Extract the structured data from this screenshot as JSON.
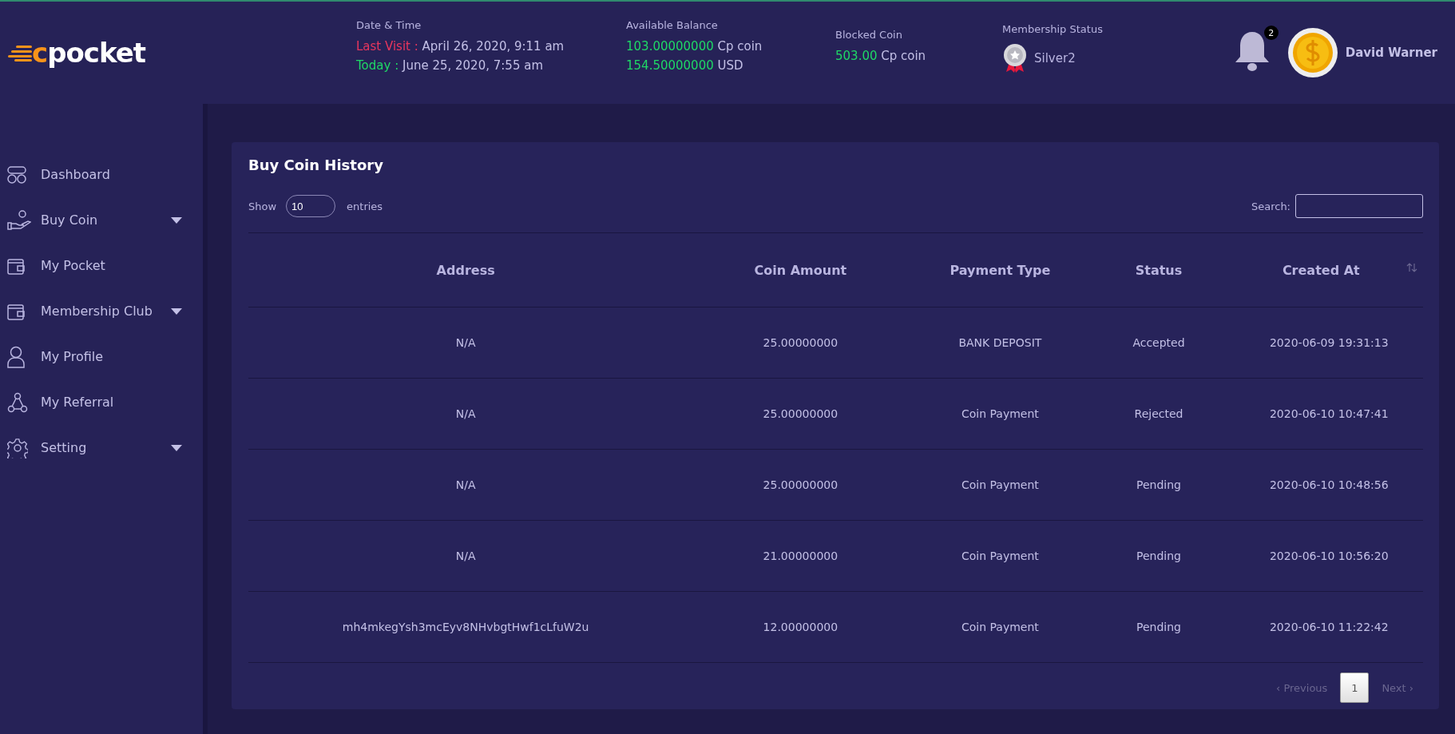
{
  "logo": {
    "accent": "c",
    "text": "pocket"
  },
  "header_info": [
    {
      "label": "Date & Time",
      "lines": [
        {
          "prefix": "Last Visit :",
          "value": " April 26, 2020, 9:11 am",
          "color": "#e8365d"
        },
        {
          "prefix": "Today :",
          "value": " June 25, 2020, 7:55 am",
          "color": "#1fd866"
        }
      ]
    },
    {
      "label": "Available Balance",
      "lines": [
        {
          "prefix": "103.00000000",
          "value": " Cp coin",
          "color": "#1fd866"
        },
        {
          "prefix": "154.50000000",
          "value": " USD",
          "color": "#1fd866"
        }
      ]
    },
    {
      "label": "Blocked Coin",
      "lines": [
        {
          "prefix": "503.00",
          "value": " Cp coin",
          "color": "#1fd866"
        }
      ]
    }
  ],
  "membership": {
    "label": "Membership Status",
    "value": "Silver2"
  },
  "notifications": {
    "count": "2"
  },
  "user": {
    "name": "David Warner"
  },
  "sidebar": {
    "items": [
      {
        "label": "Dashboard",
        "kind": "link"
      },
      {
        "label": "Buy Coin",
        "kind": "dropdown"
      },
      {
        "label": "My Pocket",
        "kind": "link"
      },
      {
        "label": "Membership Club",
        "kind": "dropdown"
      },
      {
        "label": "My Profile",
        "kind": "link"
      },
      {
        "label": "My Referral",
        "kind": "link"
      },
      {
        "label": "Setting",
        "kind": "dropdown"
      }
    ]
  },
  "card": {
    "title": "Buy Coin History",
    "show_label": "Show",
    "entries_value": "10",
    "entries_label": "entries",
    "search_label": "Search:"
  },
  "table": {
    "columns": [
      "Address",
      "Coin Amount",
      "Payment Type",
      "Status",
      "Created At"
    ],
    "rows": [
      [
        "N/A",
        "25.00000000",
        "BANK DEPOSIT",
        "Accepted",
        "2020-06-09 19:31:13"
      ],
      [
        "N/A",
        "25.00000000",
        "Coin Payment",
        "Rejected",
        "2020-06-10 10:47:41"
      ],
      [
        "N/A",
        "25.00000000",
        "Coin Payment",
        "Pending",
        "2020-06-10 10:48:56"
      ],
      [
        "N/A",
        "21.00000000",
        "Coin Payment",
        "Pending",
        "2020-06-10 10:56:20"
      ],
      [
        "mh4mkegYsh3mcEyv8NHvbgtHwf1cLfuW2u",
        "12.00000000",
        "Coin Payment",
        "Pending",
        "2020-06-10 11:22:42"
      ]
    ]
  },
  "pagination": {
    "previous": {
      "label": "‹ Previous",
      "disabled": true
    },
    "pages": [
      {
        "label": "1",
        "selected": true
      }
    ],
    "next": {
      "label": "Next ›",
      "disabled": true
    }
  }
}
